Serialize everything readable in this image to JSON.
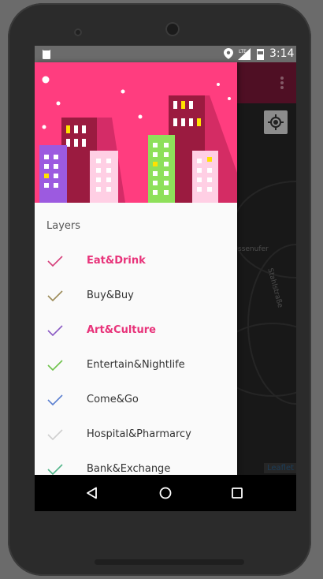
{
  "status_bar": {
    "time": "3:14",
    "network_label": "LTE",
    "icons": [
      "sd-card-icon",
      "location-icon",
      "signal-icon",
      "battery-icon"
    ]
  },
  "map": {
    "attribution": "Leaflet",
    "street_labels": [
      "ssenufer",
      "Stahlstraße"
    ],
    "overflow_menu_icon": "more-vert-icon",
    "locate_icon": "my-location-icon"
  },
  "drawer": {
    "section_title": "Layers",
    "items": [
      {
        "label": "Eat&Drink",
        "check_color": "#d63f7a",
        "label_color": "#e8337a",
        "highlighted": true
      },
      {
        "label": "Buy&Buy",
        "check_color": "#9c8b58",
        "label_color": "#333333",
        "highlighted": false
      },
      {
        "label": "Art&Culture",
        "check_color": "#8b5ac4",
        "label_color": "#e8337a",
        "highlighted": true
      },
      {
        "label": "Entertain&Nightlife",
        "check_color": "#6ec24a",
        "label_color": "#333333",
        "highlighted": false
      },
      {
        "label": "Come&Go",
        "check_color": "#5a7fd0",
        "label_color": "#333333",
        "highlighted": false
      },
      {
        "label": "Hospital&Pharmarcy",
        "check_color": "#cfcfcf",
        "label_color": "#333333",
        "highlighted": false
      },
      {
        "label": "Bank&Exchange",
        "check_color": "#52b58a",
        "label_color": "#333333",
        "highlighted": false
      }
    ]
  },
  "colors": {
    "header_pink": "#ff3d7f",
    "accent_pink": "#e8337a",
    "app_bar": "#7a1738"
  },
  "nav": {
    "back_icon": "back-triangle-icon",
    "home_icon": "home-circle-icon",
    "recents_icon": "recents-square-icon"
  }
}
